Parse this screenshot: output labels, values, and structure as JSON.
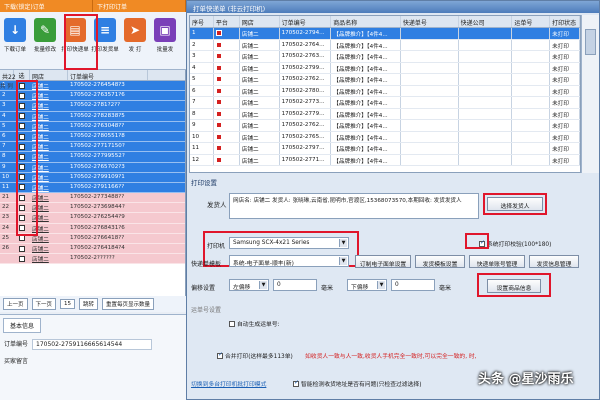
{
  "bg": {
    "tabs": [
      "下载(锁定)订单",
      "下打印订单"
    ],
    "toolbar": [
      {
        "label": "下载订单",
        "icon": "download-icon",
        "color": "#2f7fe2"
      },
      {
        "label": "批量修改",
        "icon": "pencil-icon",
        "color": "#3a9d3a"
      },
      {
        "label": "打印快递单",
        "icon": "printer-icon",
        "color": "#e46a2b"
      },
      {
        "label": "打印发货单",
        "icon": "document-icon",
        "color": "#2f7fe2"
      },
      {
        "label": "发 打",
        "icon": "send-icon",
        "color": "#e46a2b"
      },
      {
        "label": "批量发",
        "icon": "truck-icon",
        "color": "#7a3fb8"
      }
    ],
    "grid_head": [
      "共22",
      "选",
      "网店",
      "订单编号"
    ],
    "rows": [
      {
        "num": "1",
        "shop": "店铺二",
        "order": "170502-2764548?3",
        "sel": true
      },
      {
        "num": "2",
        "shop": "店铺二",
        "order": "170502-2763571?6",
        "sel": true
      },
      {
        "num": "3",
        "shop": "店铺二",
        "order": "170502-2781?2??",
        "sel": true
      },
      {
        "num": "4",
        "shop": "店铺二",
        "order": "170502-2782838?5",
        "sel": true
      },
      {
        "num": "5",
        "shop": "店铺二",
        "order": "170502-2763048??",
        "sel": true
      },
      {
        "num": "6",
        "shop": "店铺二",
        "order": "170502-2780551?8",
        "sel": true
      },
      {
        "num": "7",
        "shop": "店铺二",
        "order": "170502-27717150?",
        "sel": true
      },
      {
        "num": "8",
        "shop": "店铺二",
        "order": "170502-27799552?",
        "sel": true
      },
      {
        "num": "9",
        "shop": "店铺二",
        "order": "170502-2765702?3",
        "sel": true
      },
      {
        "num": "10",
        "shop": "店铺二",
        "order": "170502-2799109?1",
        "sel": true
      },
      {
        "num": "11",
        "shop": "店铺二",
        "order": "170502-2791166??",
        "sel": true
      },
      {
        "num": "21",
        "shop": "店铺二",
        "order": "170502-2773488??",
        "sel": false
      },
      {
        "num": "22",
        "shop": "店铺二",
        "order": "170502-27369844?",
        "sel": false
      },
      {
        "num": "23",
        "shop": "店铺二",
        "order": "170502-2762544?9",
        "sel": false
      },
      {
        "num": "24",
        "shop": "店铺二",
        "order": "170502-2768431?6",
        "sel": false
      },
      {
        "num": "25",
        "shop": "店铺二",
        "order": "170502-2766418??",
        "sel": false
      },
      {
        "num": "26",
        "shop": "店铺二",
        "order": "170502-2764184?4",
        "sel": false
      },
      {
        "num": "",
        "shop": "店铺二",
        "order": "170502-2??????",
        "sel": false
      }
    ],
    "fold_label": "共 列",
    "pager": {
      "prev": "上一页",
      "next": "下一页",
      "go": "跳转",
      "clear": "重置每页显示数量",
      "count": "15"
    },
    "info_tab": "基本信息",
    "order_label": "订单编号",
    "order_value": "170502-2759116665614544",
    "buyer_label": "买家留言"
  },
  "dialog": {
    "title": "打单快递单 (非云打印机)",
    "headers": [
      "序号",
      "平台",
      "网店",
      "订单编号",
      "商品名称",
      "快递单号",
      "快递公司",
      "运单号",
      "打印状态"
    ],
    "rows": [
      {
        "no": "1",
        "shop": "店铺二",
        "order": "170502-2794...",
        "goods": "【品牌推介】【4件4...",
        "status": "未打印",
        "sel": true
      },
      {
        "no": "2",
        "shop": "店铺二",
        "order": "170502-2764...",
        "goods": "【品牌推介】【4件4...",
        "status": "未打印",
        "sel": false
      },
      {
        "no": "3",
        "shop": "店铺二",
        "order": "170502-2763...",
        "goods": "【品牌推介】【4件4...",
        "status": "未打印",
        "sel": false
      },
      {
        "no": "4",
        "shop": "店铺二",
        "order": "170502-2799...",
        "goods": "【品牌推介】【4件4...",
        "status": "未打印",
        "sel": false
      },
      {
        "no": "5",
        "shop": "店铺二",
        "order": "170502-2762...",
        "goods": "【品牌推介】【4件4...",
        "status": "未打印",
        "sel": false
      },
      {
        "no": "6",
        "shop": "店铺二",
        "order": "170502-2780...",
        "goods": "【品牌推介】【4件4...",
        "status": "未打印",
        "sel": false
      },
      {
        "no": "7",
        "shop": "店铺二",
        "order": "170502-2773...",
        "goods": "【品牌推介】【4件4...",
        "status": "未打印",
        "sel": false
      },
      {
        "no": "8",
        "shop": "店铺二",
        "order": "170502-2779...",
        "goods": "【品牌推介】【4件4...",
        "status": "未打印",
        "sel": false
      },
      {
        "no": "9",
        "shop": "店铺二",
        "order": "170502-2762...",
        "goods": "【品牌推介】【4件4...",
        "status": "未打印",
        "sel": false
      },
      {
        "no": "10",
        "shop": "店铺二",
        "order": "170502-2765...",
        "goods": "【品牌推介】【4件4...",
        "status": "未打印",
        "sel": false
      },
      {
        "no": "11",
        "shop": "店铺二",
        "order": "170502-2797...",
        "goods": "【品牌推介】【4件4...",
        "status": "未打印",
        "sel": false
      },
      {
        "no": "12",
        "shop": "店铺二",
        "order": "170502-2771...",
        "goods": "【品牌推介】【4件4...",
        "status": "未打印",
        "sel": false
      }
    ],
    "settings_title": "打印设置",
    "sender_label": "发货人",
    "sender_value": "网店名: 店铺二 发货人: 张晓琳,云南省,昆明市,官渡区,15368073570,本期回收: 发货发货人",
    "select_sender": "选择发货人",
    "printer_label": "打印机",
    "printer_value": "Samsung SCX-4x21 Series",
    "print_fail_cb": "系统打印校验(100*180)",
    "template_label": "快递单模板",
    "template_value": "系统-电子面单-顺丰(新)",
    "btn_express_setting": "订制电子面单设置",
    "btn_template_mgr": "发货模板设置",
    "btn_account": "快递单账号管理",
    "btn_sender_mgr": "发货信息管理",
    "offset_label": "偏移设置",
    "offset_dir": "左偏移",
    "offset_val": "0",
    "offset_unit": "毫米",
    "offset_dir2": "下偏移",
    "offset_val2": "0",
    "offset_unit2": "毫米",
    "set_goods_btn": "设置商品信息",
    "waybill_label": "运单号设置",
    "waybill_cb": "自动生成运单号:",
    "merge_cb": "合并打印(这样最多113单)",
    "merge_note": "如收货人一致与人一致,收货人手机完全一致时,可以完全一致的, 时,",
    "link_batch": "切换到多台打印机批打印模式",
    "smart_cb": "智能检测收货地址是否有问题(只检查过滤选择)"
  },
  "watermark": "头条 @星沙雨乐"
}
